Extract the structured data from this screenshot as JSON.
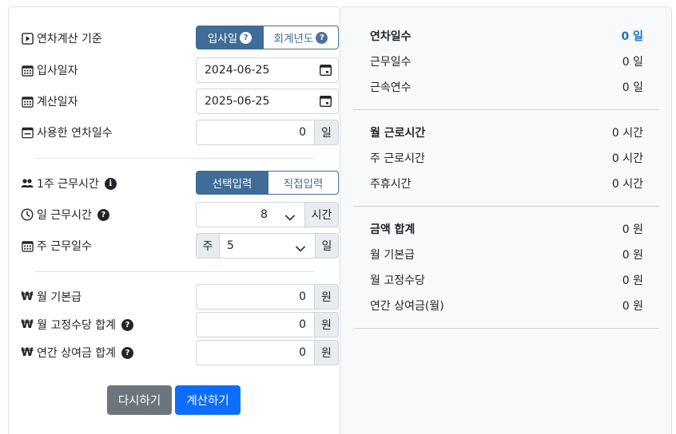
{
  "form": {
    "basis": {
      "label": "연차계산 기준",
      "option_hire": "입사일",
      "option_fiscal": "회계년도",
      "selected": "입사일"
    },
    "hire_date": {
      "label": "입사일자",
      "value": "2024-06-25"
    },
    "calc_date": {
      "label": "계산일자",
      "value": "2025-06-25"
    },
    "used_leave": {
      "label": "사용한 연차일수",
      "value": "0",
      "unit": "일"
    },
    "weekly_hours": {
      "label": "1주 근무시간",
      "option_select": "선택입력",
      "option_direct": "직접입력",
      "selected": "선택입력"
    },
    "daily_hours": {
      "label": "일 근무시간",
      "value": "8",
      "unit": "시간"
    },
    "weekly_days": {
      "label": "주 근무일수",
      "prefix": "주",
      "value": "5",
      "unit": "일"
    },
    "monthly_base": {
      "label": "월 기본급",
      "value": "0",
      "unit": "원"
    },
    "monthly_allowance": {
      "label": "월 고정수당 합계",
      "value": "0",
      "unit": "원"
    },
    "annual_bonus": {
      "label": "연간 상여금 합계",
      "value": "0",
      "unit": "원"
    },
    "reset_label": "다시하기",
    "calc_label": "계산하기"
  },
  "result": {
    "leave_days": {
      "label": "연차일수",
      "value": "0 일"
    },
    "work_days": {
      "label": "근무일수",
      "value": "0 일"
    },
    "service_years": {
      "label": "근속연수",
      "value": "0 일"
    },
    "monthly_hours": {
      "label": "월 근로시간",
      "value": "0 시간"
    },
    "weekly_hours": {
      "label": "주 근로시간",
      "value": "0 시간"
    },
    "weekly_rest": {
      "label": "주휴시간",
      "value": "0 시간"
    },
    "total_amount": {
      "label": "금액 합계",
      "value": "0 원"
    },
    "monthly_base": {
      "label": "월 기본급",
      "value": "0 원"
    },
    "monthly_allowance": {
      "label": "월 고정수당",
      "value": "0 원"
    },
    "annual_bonus": {
      "label": "연간 상여금(월)",
      "value": "0 원"
    }
  },
  "colors": {
    "segment_active": "#3f6d97",
    "primary": "#0d6efd",
    "secondary": "#6c757d",
    "highlight": "#1a73c9"
  },
  "icons": [
    "play-icon",
    "calendar-icon",
    "minus-box-icon",
    "people-icon",
    "info-icon",
    "clock-icon",
    "help-icon",
    "won-icon"
  ]
}
